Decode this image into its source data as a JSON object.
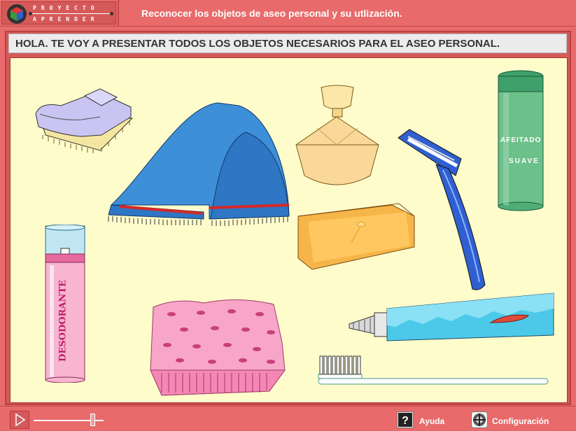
{
  "header": {
    "logo_line1": "PROYECTO",
    "logo_line2": "APRENDER",
    "title": "Reconocer los objetos de aseo personal y su utlización."
  },
  "instruction": "HOLA. TE VOY A PRESENTAR TODOS LOS OBJETOS NECESARIOS PARA EL ASEO PERSONAL.",
  "objects": {
    "shaving_cream_label_top": "AFEITADO",
    "shaving_cream_label_bottom": "SUAVE",
    "deodorant_label": "DESODORANTE"
  },
  "footer": {
    "help_label": "Ayuda",
    "config_label": "Configuración"
  },
  "colors": {
    "chrome": "#e86a6a",
    "stage": "#fffccc",
    "towel": "#3d8fd8",
    "soap": "#f6b548",
    "sponge": "#f7a6c7"
  },
  "icons": [
    "cube-logo-icon",
    "play-icon",
    "help-icon",
    "config-icon"
  ]
}
